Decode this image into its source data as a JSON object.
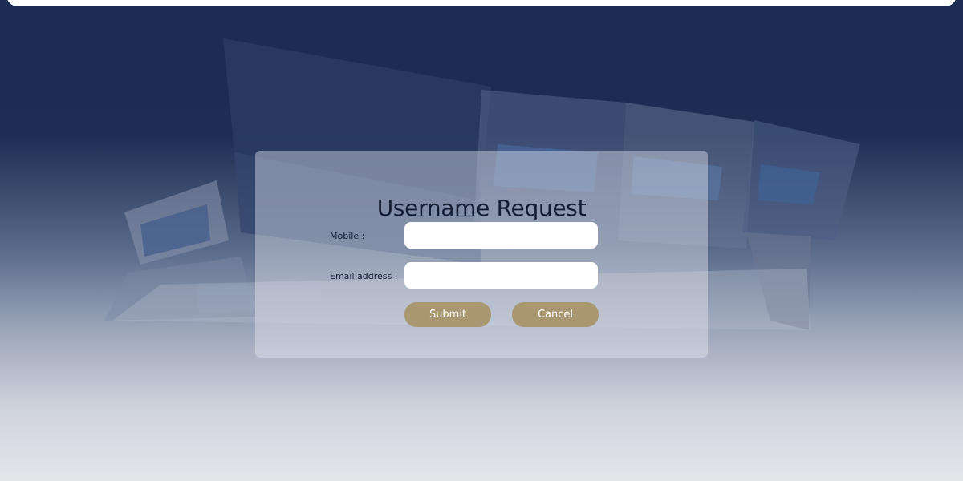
{
  "form": {
    "title": "Username Request",
    "fields": {
      "mobile": {
        "label": "Mobile :",
        "value": "",
        "placeholder": ""
      },
      "email": {
        "label": "Email address :",
        "value": "",
        "placeholder": ""
      }
    },
    "buttons": {
      "submit": "Submit",
      "cancel": "Cancel"
    }
  },
  "colors": {
    "background_top": "#1b2b52",
    "background_bottom": "#e3e5e9",
    "button": "#a89770",
    "card": "#e6e9f0"
  }
}
